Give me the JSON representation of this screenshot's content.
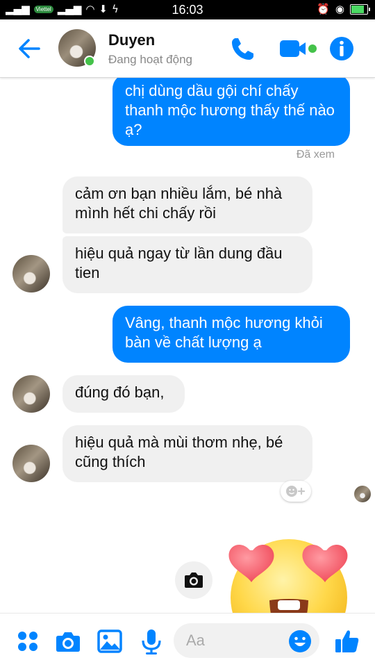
{
  "status_bar": {
    "carrier": "Viettel",
    "time": "16:03"
  },
  "header": {
    "contact_name": "Duyen",
    "contact_status": "Đang hoạt động"
  },
  "messages": [
    {
      "sender": "me",
      "text": "chị dùng dầu gội chí chấy thanh mộc hương thấy thế nào ạ?"
    },
    {
      "sender": "contact",
      "text": "cảm ơn bạn nhiều lắm, bé nhà mình hết chi chấy rồi"
    },
    {
      "sender": "contact",
      "text": "hiệu quả ngay từ lần dung đầu tien"
    },
    {
      "sender": "me",
      "text": "Vâng, thanh mộc hương khỏi bàn về chất lượng ạ"
    },
    {
      "sender": "contact",
      "text": "đúng đó bạn,"
    },
    {
      "sender": "contact",
      "text": "hiệu quả mà mùi thơm nhẹ, bé cũng thích"
    }
  ],
  "seen_label": "Đã xem",
  "big_emoji": "heart-eyes",
  "composer": {
    "placeholder": "Aa"
  },
  "colors": {
    "accent": "#0084ff",
    "incoming_bubble": "#f0f0f0",
    "online": "#44c24a"
  }
}
